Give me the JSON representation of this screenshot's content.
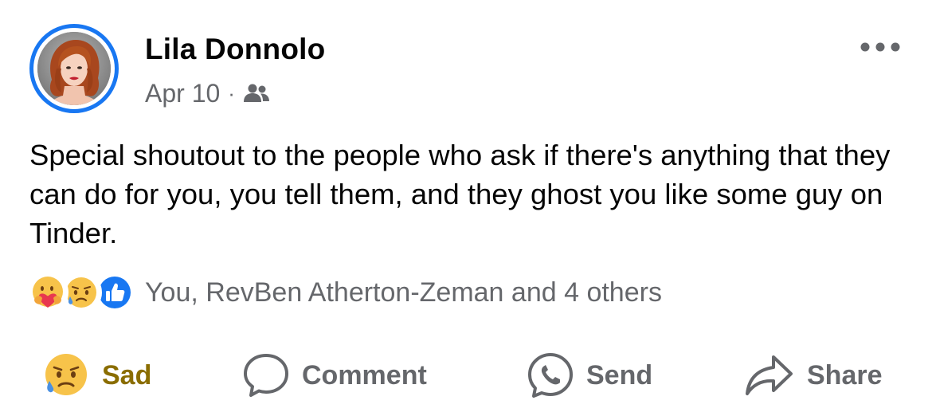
{
  "post": {
    "author": "Lila Donnolo",
    "date": "Apr 10",
    "separator": "·",
    "audience_icon": "friends-icon",
    "text": "Special shoutout to the people who ask if there's anything that they can do for you, you tell them, and they ghost you like some guy on Tinder.",
    "more_icon": "more-options-icon"
  },
  "reactions": {
    "icons": [
      "care-reaction-icon",
      "sad-reaction-icon",
      "like-reaction-icon"
    ],
    "summary": "You, RevBen Atherton-Zeman and 4 others"
  },
  "actions": {
    "react_label": "Sad",
    "comment_label": "Comment",
    "send_label": "Send",
    "share_label": "Share"
  },
  "colors": {
    "accent": "#1877f2",
    "secondary_text": "#65676b",
    "sad_label": "#8a6d00"
  }
}
